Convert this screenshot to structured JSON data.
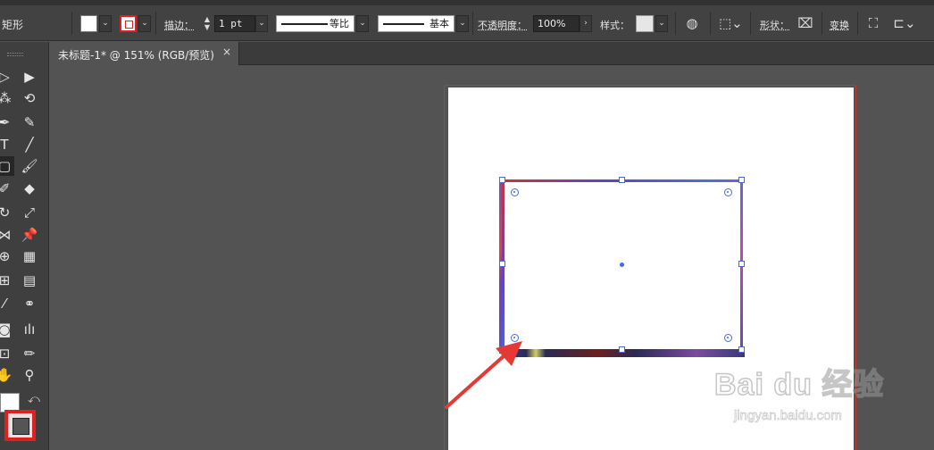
{
  "control_bar": {
    "tool_name": "矩形",
    "stroke_label": "描边：",
    "stroke_weight": "1 pt",
    "profile_label": "等比",
    "brush_label": "基本",
    "opacity_label": "不透明度：",
    "opacity_value": "100%",
    "style_label": "样式：",
    "shape_label": "形状：",
    "transform_label": "变换",
    "colors": {
      "fill": "#ffffff",
      "stroke": "#e02020"
    }
  },
  "document": {
    "tab_title": "未标题-1* @ 151% (RGB/预览)",
    "tab_close": "×"
  },
  "watermark": {
    "main": "Bai du 经验",
    "sub": "jingyan.baidu.com"
  },
  "colors": {
    "selection": "#4a6ad8",
    "artboard_border": "#c0392b",
    "annotation_arrow": "#e53935"
  }
}
